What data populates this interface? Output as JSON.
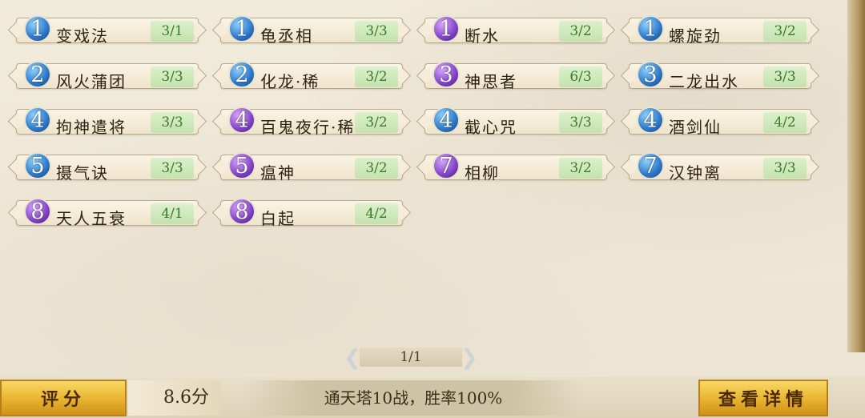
{
  "rows": [
    [
      {
        "num": "1",
        "color": "blue",
        "name": "变戏法",
        "score": "3/1"
      },
      {
        "num": "1",
        "color": "blue",
        "name": "龟丞相",
        "score": "3/3"
      },
      {
        "num": "1",
        "color": "purple",
        "name": "断水",
        "score": "3/2"
      },
      {
        "num": "1",
        "color": "blue",
        "name": "螺旋劲",
        "score": "3/2"
      }
    ],
    [
      {
        "num": "2",
        "color": "blue",
        "name": "风火蒲团",
        "score": "3/3"
      },
      {
        "num": "2",
        "color": "blue",
        "name": "化龙·稀",
        "score": "3/2"
      },
      {
        "num": "3",
        "color": "purple",
        "name": "神思者",
        "score": "6/3"
      },
      {
        "num": "3",
        "color": "blue",
        "name": "二龙出水",
        "score": "3/3"
      }
    ],
    [
      {
        "num": "4",
        "color": "blue",
        "name": "拘神遣将",
        "score": "3/3"
      },
      {
        "num": "4",
        "color": "purple",
        "name": "百鬼夜行·稀",
        "score": "3/2"
      },
      {
        "num": "4",
        "color": "blue",
        "name": "截心咒",
        "score": "3/3"
      },
      {
        "num": "4",
        "color": "blue",
        "name": "酒剑仙",
        "score": "4/2"
      }
    ],
    [
      {
        "num": "5",
        "color": "blue",
        "name": "摄气诀",
        "score": "3/3"
      },
      {
        "num": "5",
        "color": "purple",
        "name": "瘟神",
        "score": "3/2"
      },
      {
        "num": "7",
        "color": "purple",
        "name": "相柳",
        "score": "3/2"
      },
      {
        "num": "7",
        "color": "blue",
        "name": "汉钟离",
        "score": "3/3"
      }
    ],
    [
      {
        "num": "8",
        "color": "purple",
        "name": "天人五衰",
        "score": "4/1"
      },
      {
        "num": "8",
        "color": "purple",
        "name": "白起",
        "score": "4/2"
      }
    ]
  ],
  "pager": {
    "text": "1/1",
    "prev_icon": "scroll-left-icon",
    "next_icon": "scroll-right-icon"
  },
  "bottom": {
    "rate_label": "评分",
    "rate_value": "8.6分",
    "summary": "通天塔10战，胜率100%",
    "detail_button": "查看详情"
  },
  "colors": {
    "blue": "#2c78c8",
    "purple": "#8343c6",
    "score_green": "#3c7a2c",
    "gold": "#eab632"
  }
}
